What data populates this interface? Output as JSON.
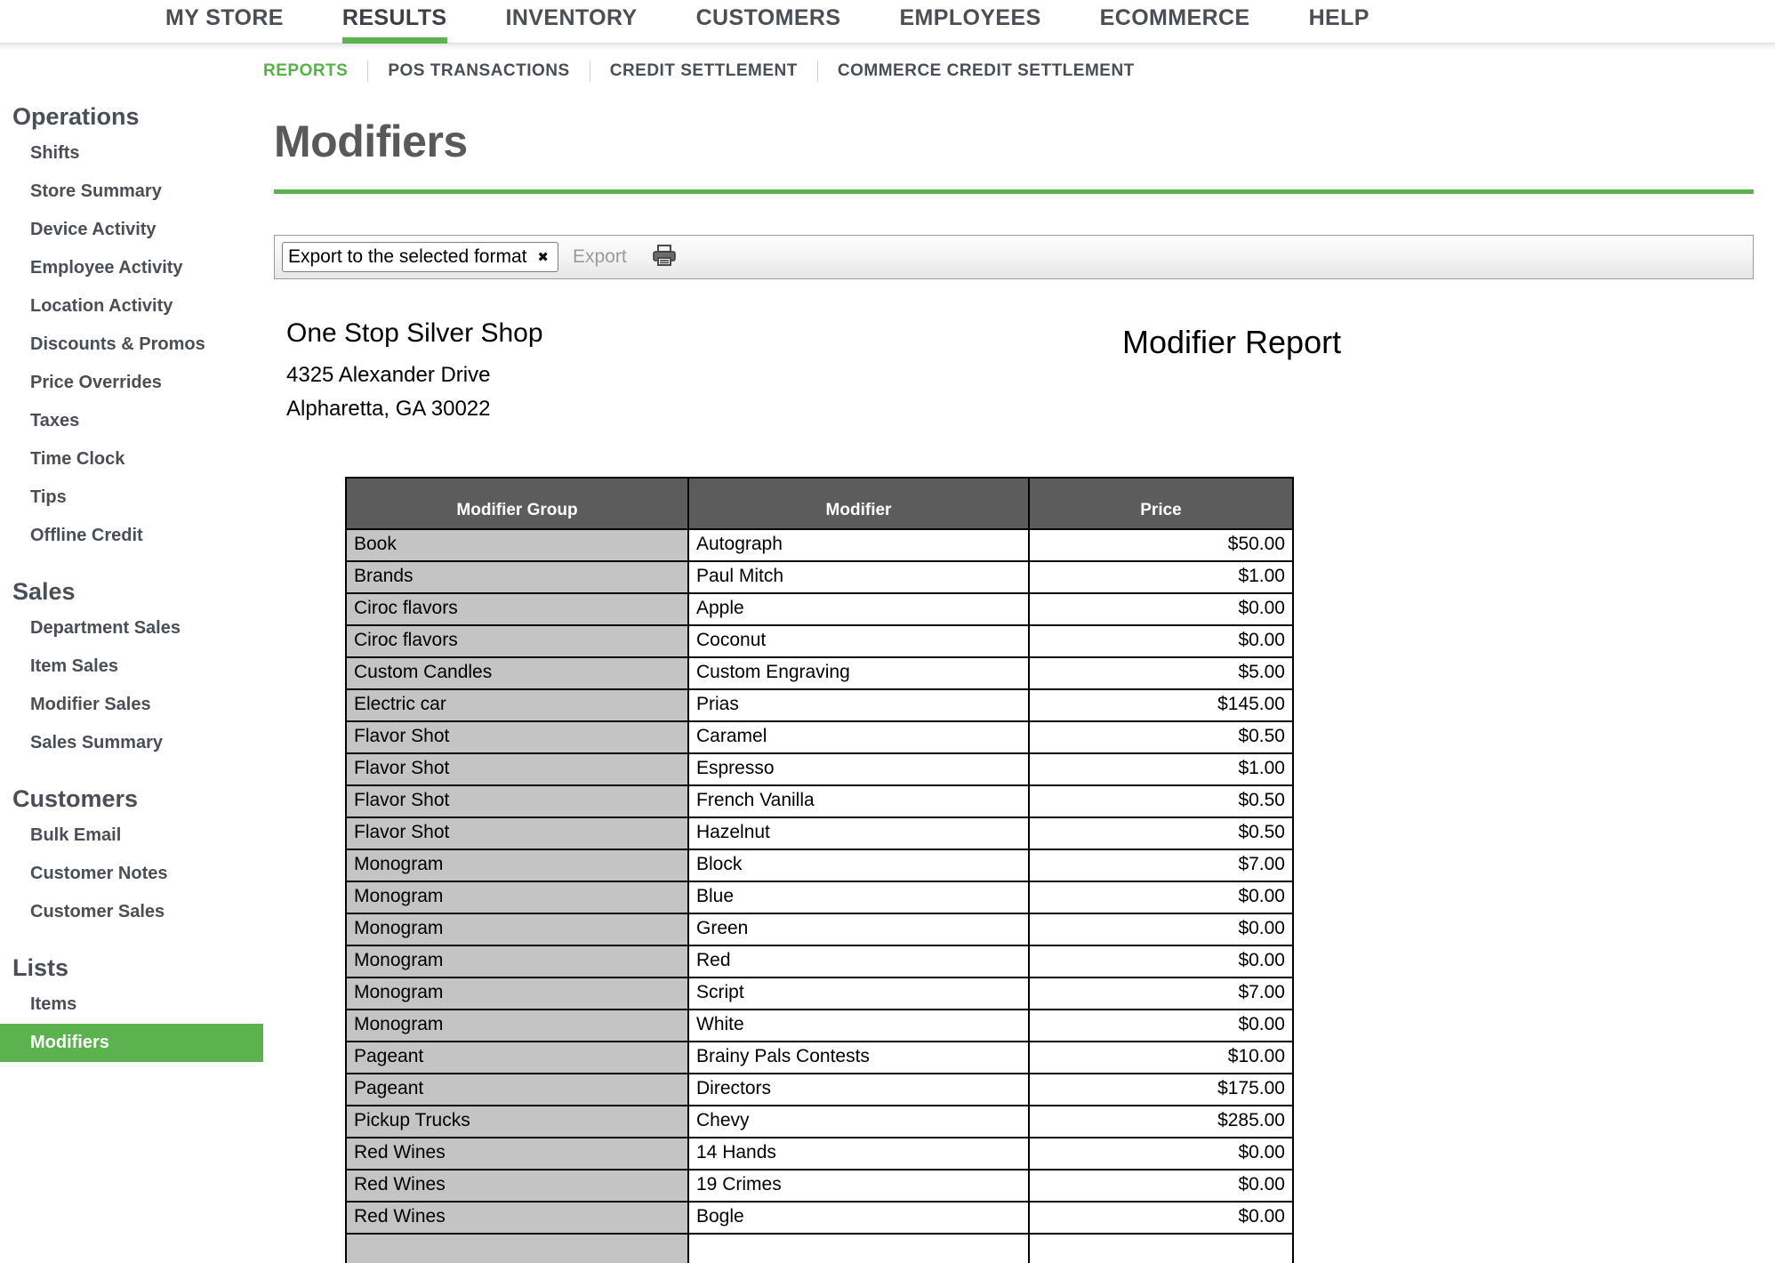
{
  "top_nav": {
    "items": [
      {
        "label": "MY STORE",
        "active": false
      },
      {
        "label": "RESULTS",
        "active": true
      },
      {
        "label": "INVENTORY",
        "active": false
      },
      {
        "label": "CUSTOMERS",
        "active": false
      },
      {
        "label": "EMPLOYEES",
        "active": false
      },
      {
        "label": "ECOMMERCE",
        "active": false
      },
      {
        "label": "HELP",
        "active": false
      }
    ]
  },
  "sub_nav": {
    "items": [
      {
        "label": "REPORTS",
        "active": true
      },
      {
        "label": "POS TRANSACTIONS",
        "active": false
      },
      {
        "label": "CREDIT SETTLEMENT",
        "active": false
      },
      {
        "label": "COMMERCE CREDIT SETTLEMENT",
        "active": false
      }
    ]
  },
  "sidebar": {
    "groups": [
      {
        "title": "Operations",
        "items": [
          {
            "label": "Shifts",
            "active": false
          },
          {
            "label": "Store Summary",
            "active": false
          },
          {
            "label": "Device Activity",
            "active": false
          },
          {
            "label": "Employee Activity",
            "active": false
          },
          {
            "label": "Location Activity",
            "active": false
          },
          {
            "label": "Discounts & Promos",
            "active": false
          },
          {
            "label": "Price Overrides",
            "active": false
          },
          {
            "label": "Taxes",
            "active": false
          },
          {
            "label": "Time Clock",
            "active": false
          },
          {
            "label": "Tips",
            "active": false
          },
          {
            "label": "Offline Credit",
            "active": false
          }
        ]
      },
      {
        "title": "Sales",
        "items": [
          {
            "label": "Department Sales",
            "active": false
          },
          {
            "label": "Item Sales",
            "active": false
          },
          {
            "label": "Modifier Sales",
            "active": false
          },
          {
            "label": "Sales Summary",
            "active": false
          }
        ]
      },
      {
        "title": "Customers",
        "items": [
          {
            "label": "Bulk Email",
            "active": false
          },
          {
            "label": "Customer Notes",
            "active": false
          },
          {
            "label": "Customer Sales",
            "active": false
          }
        ]
      },
      {
        "title": "Lists",
        "items": [
          {
            "label": "Items",
            "active": false
          },
          {
            "label": "Modifiers",
            "active": true
          }
        ]
      }
    ]
  },
  "page": {
    "title": "Modifiers"
  },
  "toolbar": {
    "export_select_value": "Export to the selected format",
    "export_select_options": [
      "Export to the selected format"
    ],
    "export_label": "Export",
    "print_icon": "printer-icon",
    "caret_icon": "chevron-down-icon"
  },
  "report": {
    "store_name": "One Stop Silver Shop",
    "address_line1": "4325 Alexander Drive",
    "address_line2": "Alpharetta, GA 30022",
    "report_title": "Modifier Report"
  },
  "table": {
    "columns": [
      "Modifier Group",
      "Modifier",
      "Price"
    ],
    "rows": [
      [
        "Book",
        "Autograph",
        "$50.00"
      ],
      [
        "Brands",
        "Paul Mitch",
        "$1.00"
      ],
      [
        "Ciroc flavors",
        "Apple",
        "$0.00"
      ],
      [
        "Ciroc flavors",
        "Coconut",
        "$0.00"
      ],
      [
        "Custom Candles",
        "Custom Engraving",
        "$5.00"
      ],
      [
        "Electric car",
        "Prias",
        "$145.00"
      ],
      [
        "Flavor Shot",
        "Caramel",
        "$0.50"
      ],
      [
        "Flavor Shot",
        "Espresso",
        "$1.00"
      ],
      [
        "Flavor Shot",
        "French Vanilla",
        "$0.50"
      ],
      [
        "Flavor Shot",
        "Hazelnut",
        "$0.50"
      ],
      [
        "Monogram",
        "Block",
        "$7.00"
      ],
      [
        "Monogram",
        "Blue",
        "$0.00"
      ],
      [
        "Monogram",
        "Green",
        "$0.00"
      ],
      [
        "Monogram",
        "Red",
        "$0.00"
      ],
      [
        "Monogram",
        "Script",
        "$7.00"
      ],
      [
        "Monogram",
        "White",
        "$0.00"
      ],
      [
        "Pageant",
        "Brainy Pals Contests",
        "$10.00"
      ],
      [
        "Pageant",
        "Directors",
        "$175.00"
      ],
      [
        "Pickup Trucks",
        "Chevy",
        "$285.00"
      ],
      [
        "Red Wines",
        "14 Hands",
        "$0.00"
      ],
      [
        "Red Wines",
        "19 Crimes",
        "$0.00"
      ],
      [
        "Red Wines",
        "Bogle",
        "$0.00"
      ],
      [
        "",
        "",
        ""
      ]
    ]
  },
  "colors": {
    "accent_green": "#5cb24e",
    "nav_text": "#4a4f55",
    "table_header_bg": "#5c5c5c",
    "group_cell_bg": "#c4c4c4"
  }
}
